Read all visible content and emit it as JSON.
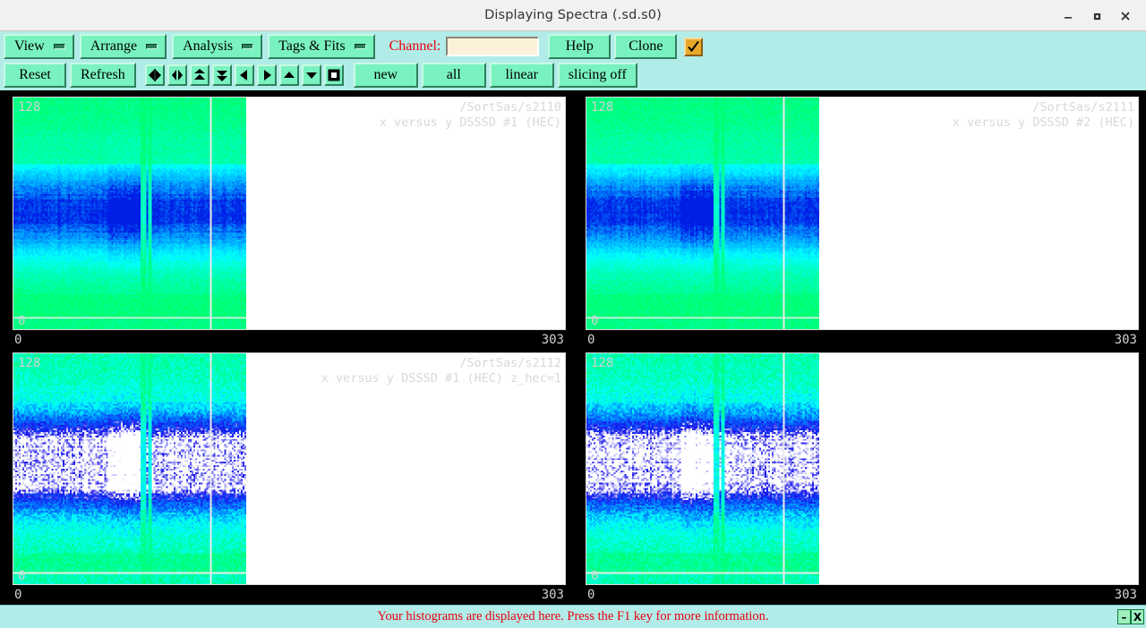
{
  "window": {
    "title": "Displaying Spectra (.sd.s0)",
    "controls": [
      {
        "name": "minimize-button",
        "glyph": "minimize"
      },
      {
        "name": "maximize-button",
        "glyph": "maximize"
      },
      {
        "name": "close-button",
        "glyph": "close"
      }
    ]
  },
  "toolbar": {
    "menus": [
      {
        "label": "View"
      },
      {
        "label": "Arrange"
      },
      {
        "label": "Analysis"
      },
      {
        "label": "Tags & Fits"
      }
    ],
    "channel_label": "Channel:",
    "channel_value": "",
    "channel_placeholder": "",
    "help_label": "Help",
    "clone_label": "Clone",
    "checkbox_checked": true,
    "reset_label": "Reset",
    "refresh_label": "Refresh",
    "nav_icons": [
      {
        "name": "collapse-horizontal-icon"
      },
      {
        "name": "expand-horizontal-icon"
      },
      {
        "name": "expand-up-icon"
      },
      {
        "name": "expand-down-icon"
      },
      {
        "name": "arrow-left-icon"
      },
      {
        "name": "arrow-right-icon"
      },
      {
        "name": "arrow-up-icon"
      },
      {
        "name": "arrow-down-icon"
      },
      {
        "name": "stop-square-icon"
      }
    ],
    "mode_buttons": [
      {
        "label": "new"
      },
      {
        "label": "all"
      },
      {
        "label": "linear"
      },
      {
        "label": "slicing off"
      }
    ]
  },
  "colors": {
    "toolbar_bg": "#b2ece8",
    "button_face": "#79f2c0",
    "accent_red": "#e8000d",
    "checkbox_gold": "#e8a92b",
    "canvas_bg": "#ffffff",
    "plot_area_bg": "#000000"
  },
  "plots": [
    {
      "path": "/SortSas/s2110",
      "subtitle": "x versus y DSSSD #1 (HEC)",
      "y_max": "128",
      "y_min": "0",
      "x_min": "0",
      "x_max": "303",
      "style": "green-cyan"
    },
    {
      "path": "/SortSas/s2111",
      "subtitle": "x versus y DSSSD #2 (HEC)",
      "y_max": "128",
      "y_min": "0",
      "x_min": "0",
      "x_max": "303",
      "style": "green-cyan"
    },
    {
      "path": "/SortSas/s2112",
      "subtitle": "x versus y DSSSD #1 (HEC) z_hec=1",
      "y_max": "128",
      "y_min": "0",
      "x_min": "0",
      "x_max": "303",
      "style": "blue-white"
    },
    {
      "path": "",
      "subtitle": "",
      "y_max": "128",
      "y_min": "0",
      "x_min": "0",
      "x_max": "303",
      "style": "blue-white"
    }
  ],
  "status": {
    "message": "Your histograms are displayed here. Press the F1 key for more information.",
    "minimize_label": "–",
    "close_label": "X"
  }
}
